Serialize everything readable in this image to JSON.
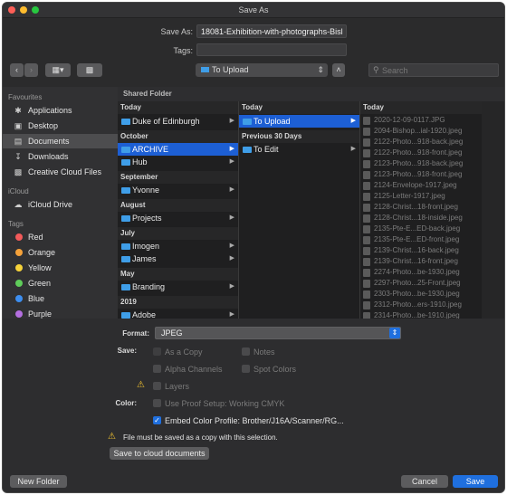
{
  "window": {
    "title": "Save As",
    "traffic_lights": {
      "close": "#fe5f57",
      "minimize": "#febc2e",
      "zoom": "#28c840"
    }
  },
  "save_as": {
    "label": "Save As:",
    "value": "18081-Exhibition-with-photographs-Bisl"
  },
  "tags": {
    "label": "Tags:",
    "value": ""
  },
  "toolbar": {
    "back_icon": "chevron-left",
    "forward_icon": "chevron-right",
    "view_icon": "column-view",
    "new_folder_icon": "folder",
    "location": "To Upload",
    "search_placeholder": "Search"
  },
  "sidebar": {
    "favourites_label": "Favourites",
    "favourites": [
      {
        "label": "Applications",
        "icon": "applications-icon"
      },
      {
        "label": "Desktop",
        "icon": "desktop-icon"
      },
      {
        "label": "Documents",
        "icon": "documents-icon",
        "selected": true
      },
      {
        "label": "Downloads",
        "icon": "downloads-icon"
      },
      {
        "label": "Creative Cloud Files",
        "icon": "creative-cloud-icon"
      }
    ],
    "icloud_label": "iCloud",
    "icloud": [
      {
        "label": "iCloud Drive",
        "icon": "cloud-icon"
      }
    ],
    "tags_label": "Tags",
    "tags": [
      {
        "label": "Red",
        "color": "#f35a5a"
      },
      {
        "label": "Orange",
        "color": "#f6a23a"
      },
      {
        "label": "Yellow",
        "color": "#f6d33a"
      },
      {
        "label": "Green",
        "color": "#5fcd5a"
      },
      {
        "label": "Blue",
        "color": "#3d8ef0"
      },
      {
        "label": "Purple",
        "color": "#b46fe0"
      }
    ]
  },
  "browser": {
    "header": "Shared Folder",
    "col1": {
      "sections": [
        {
          "header": "Today",
          "items": [
            {
              "label": "Duke of Edinburgh"
            }
          ]
        },
        {
          "header": "October",
          "items": [
            {
              "label": "ARCHIVE",
              "selected": true
            },
            {
              "label": "Hub"
            }
          ]
        },
        {
          "header": "September",
          "items": [
            {
              "label": "Yvonne"
            }
          ]
        },
        {
          "header": "August",
          "items": [
            {
              "label": "Projects"
            }
          ]
        },
        {
          "header": "July",
          "items": [
            {
              "label": "Imogen"
            },
            {
              "label": "James"
            }
          ]
        },
        {
          "header": "May",
          "items": [
            {
              "label": "Branding"
            }
          ]
        },
        {
          "header": "2019",
          "items": [
            {
              "label": "Adobe"
            }
          ]
        }
      ]
    },
    "col2": {
      "sections": [
        {
          "header": "Today",
          "items": [
            {
              "label": "To Upload",
              "selected": true
            }
          ]
        },
        {
          "header": "Previous 30 Days",
          "items": [
            {
              "label": "To Edit"
            }
          ]
        }
      ]
    },
    "col3": {
      "header": "Today",
      "files": [
        "2020-12-09-0117.JPG",
        "2094-Bishop...ial-1920.jpeg",
        "2122-Photo...918-back.jpeg",
        "2122-Photo...918-front.jpeg",
        "2123-Photo...918-back.jpeg",
        "2123-Photo...918-front.jpeg",
        "2124-Envelope-1917.jpeg",
        "2125-Letter-1917.jpeg",
        "2128-Christ...18-front.jpeg",
        "2128-Christ...18-inside.jpeg",
        "2135-Pte-E...ED-back.jpeg",
        "2135-Pte-E...ED-front.jpeg",
        "2139-Christ...16-back.jpeg",
        "2139-Christ...16-front.jpeg",
        "2274-Photo...be-1930.jpeg",
        "2297-Photo...25-Front.jpeg",
        "2303-Photo...be-1930.jpeg",
        "2312-Photo...ers-1910.jpeg",
        "2314-Photo...be-1910.jpeg"
      ]
    }
  },
  "options": {
    "format_label": "Format:",
    "format_value": "JPEG",
    "save_label": "Save:",
    "as_a_copy": "As a Copy",
    "notes": "Notes",
    "alpha_channels": "Alpha Channels",
    "spot_colors": "Spot Colors",
    "layers": "Layers",
    "color_label": "Color:",
    "use_proof_setup": "Use Proof Setup:  Working CMYK",
    "embed_color_profile": "Embed Color Profile:  Brother/J16A/Scanner/RG...",
    "warning_text": "File must be saved as a copy with this selection.",
    "cloud_button": "Save to cloud documents"
  },
  "footer": {
    "new_folder": "New Folder",
    "cancel": "Cancel",
    "save": "Save",
    "accent": "#1f6fde"
  }
}
